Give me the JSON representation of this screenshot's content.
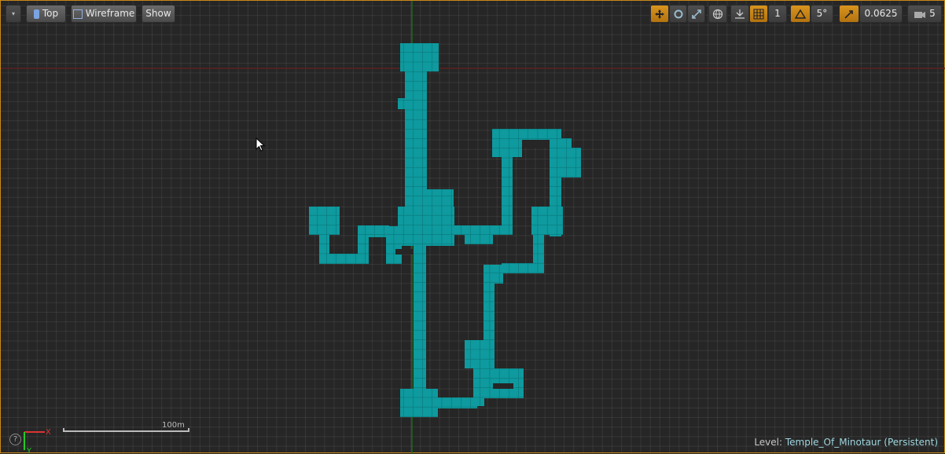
{
  "toolbar": {
    "menu_label": "▾",
    "view_mode": "Top",
    "render_mode": "Wireframe",
    "show_label": "Show",
    "grid_snap_value": "1",
    "rotation_snap_value": "5°",
    "scale_snap_value": "0.0625",
    "camera_speed_value": "5"
  },
  "icons": {
    "menu": "chevron-down-icon",
    "view": "perspective-icon",
    "render": "wireframe-icon",
    "translate": "move-icon",
    "rotate": "rotate-icon",
    "scale": "scale-icon",
    "world": "world-icon",
    "surface_snap": "surface-snap-icon",
    "grid": "grid-icon",
    "angle": "angle-icon",
    "scale_snap": "scale-snap-icon",
    "camera": "camera-icon"
  },
  "colors": {
    "accent": "#c98a1a",
    "mesh_fill": "#0e9a9e",
    "background": "#262626",
    "axis_x": "#d33",
    "axis_y": "#2c2"
  },
  "viewport": {
    "scale_label": "100m",
    "axis_x_label": "X",
    "axis_y_label": "Y",
    "level_prefix": "Level:",
    "level_name": "Temple_Of_Minotaur (Persistent)"
  }
}
